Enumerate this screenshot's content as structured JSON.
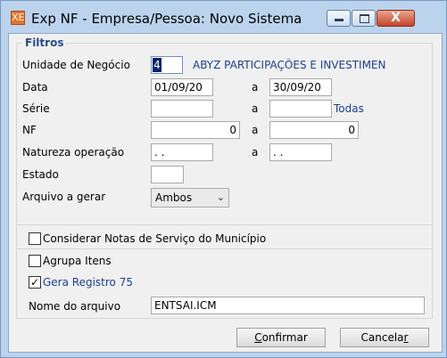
{
  "window": {
    "title": "Exp NF - Empresa/Pessoa: Novo Sistema",
    "app_icon": "XE",
    "controls": {
      "minimize_icon": "minimize-icon",
      "maximize_icon": "maximize-icon",
      "close_icon": "close-icon",
      "close_glyph": "X"
    }
  },
  "filtros": {
    "legend": "Filtros",
    "unidade": {
      "label": "Unidade de Negócio",
      "value": "4",
      "description": "ABYZ PARTICIPAÇÕES E INVESTIMEN"
    },
    "data": {
      "label": "Data",
      "from": "01/09/20",
      "sep": "a",
      "to": "30/09/20"
    },
    "serie": {
      "label": "Série",
      "from": "",
      "sep": "a",
      "to": "",
      "hint": "Todas"
    },
    "nf": {
      "label": "NF",
      "from": "0",
      "sep": "a",
      "to": "0"
    },
    "natureza": {
      "label": "Natureza operação",
      "from": ". .",
      "sep": "a",
      "to": ". ."
    },
    "estado": {
      "label": "Estado",
      "value": ""
    },
    "arquivo": {
      "label": "Arquivo a gerar",
      "selected": "Ambos"
    }
  },
  "options": {
    "considerar": {
      "label": "Considerar Notas de Serviço do Município",
      "checked": false
    },
    "agrupa": {
      "label": "Agrupa Itens",
      "checked": false
    },
    "gera": {
      "label": "Gera Registro 75",
      "checked": true,
      "mark": "✓"
    }
  },
  "nome_arquivo": {
    "label": "Nome do arquivo",
    "value": "ENTSAI.ICM"
  },
  "buttons": {
    "confirmar": {
      "accel": "C",
      "rest": "onfirmar"
    },
    "cancelar": {
      "prefix": "Cancela",
      "accel": "r"
    }
  }
}
